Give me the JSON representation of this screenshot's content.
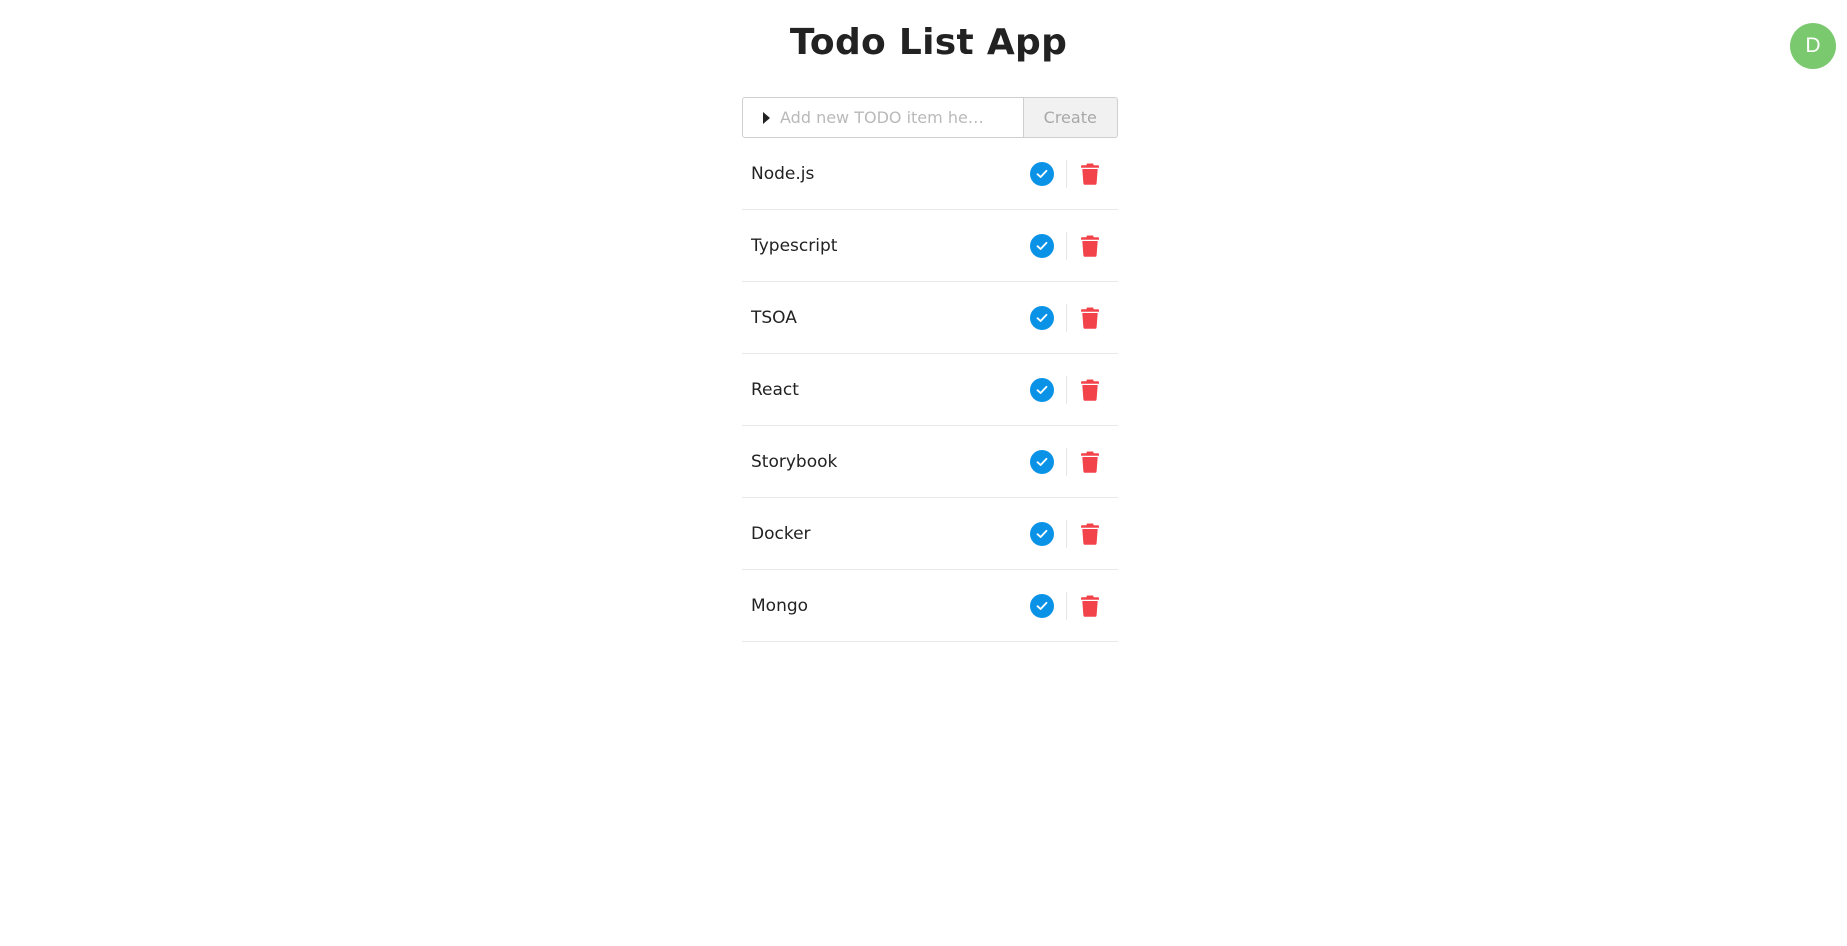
{
  "app": {
    "title": "Todo List App"
  },
  "user": {
    "avatar_initial": "D",
    "avatar_color": "#7bc96f"
  },
  "add_form": {
    "placeholder": "Add new TODO item he…",
    "value": "",
    "create_label": "Create"
  },
  "todos": [
    {
      "label": "Node.js",
      "complete_icon": "check-circle-icon",
      "delete_icon": "trash-icon"
    },
    {
      "label": "Typescript",
      "complete_icon": "check-circle-icon",
      "delete_icon": "trash-icon"
    },
    {
      "label": "TSOA",
      "complete_icon": "check-circle-icon",
      "delete_icon": "trash-icon"
    },
    {
      "label": "React",
      "complete_icon": "check-circle-icon",
      "delete_icon": "trash-icon"
    },
    {
      "label": "Storybook",
      "complete_icon": "check-circle-icon",
      "delete_icon": "trash-icon"
    },
    {
      "label": "Docker",
      "complete_icon": "check-circle-icon",
      "delete_icon": "trash-icon"
    },
    {
      "label": "Mongo",
      "complete_icon": "check-circle-icon",
      "delete_icon": "trash-icon"
    }
  ],
  "colors": {
    "check": "#0a93e6",
    "trash": "#f2434b",
    "avatar": "#7bc96f"
  }
}
